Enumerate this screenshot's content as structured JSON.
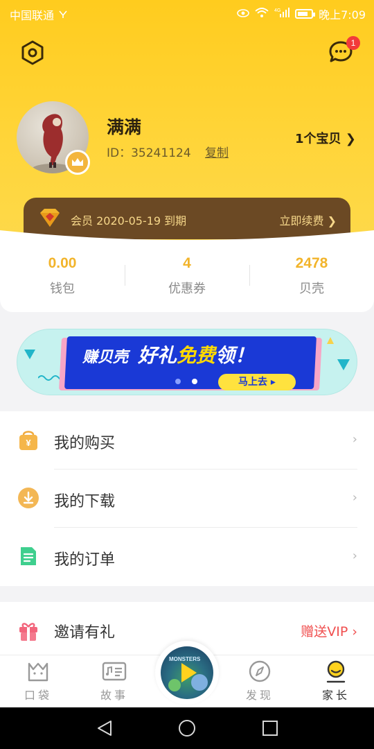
{
  "status_bar": {
    "carrier": "中国联通",
    "network": "4G",
    "time": "晚上7:09"
  },
  "header": {
    "message_badge": "1",
    "user": {
      "name": "满满",
      "id_label": "ID：",
      "id_value": "35241124",
      "copy_label": "复制"
    },
    "baby_count": "1个宝贝 ❯"
  },
  "membership": {
    "text": "会员 2020-05-19 到期",
    "renew_label": "立即续费 ❯"
  },
  "stats": [
    {
      "value": "0.00",
      "label": "钱包"
    },
    {
      "value": "4",
      "label": "优惠券"
    },
    {
      "value": "2478",
      "label": "贝壳"
    }
  ],
  "banner": {
    "title_small": "赚贝壳",
    "title_part1": "好礼",
    "title_highlight": "免费",
    "title_part2": "领！",
    "cta": "马上去 ▸"
  },
  "menu": [
    {
      "label": "我的购买",
      "icon": "shopping-bag-icon"
    },
    {
      "label": "我的下载",
      "icon": "download-icon"
    },
    {
      "label": "我的订单",
      "icon": "order-icon"
    }
  ],
  "invite": {
    "label": "邀请有礼",
    "extra": "赠送VIP ›",
    "icon": "gift-icon"
  },
  "tabs": [
    {
      "label": "口袋",
      "icon": "pocket-icon"
    },
    {
      "label": "故事",
      "icon": "story-icon"
    },
    {
      "label": "发现",
      "icon": "compass-icon"
    },
    {
      "label": "家长",
      "icon": "parent-icon"
    }
  ],
  "player": {
    "title": "MONSTERS"
  },
  "colors": {
    "brand_yellow": "#ffcc1e",
    "member_bar": "#6b4924",
    "stat_value": "#f2b42b",
    "invite_extra": "#f04f4f"
  }
}
